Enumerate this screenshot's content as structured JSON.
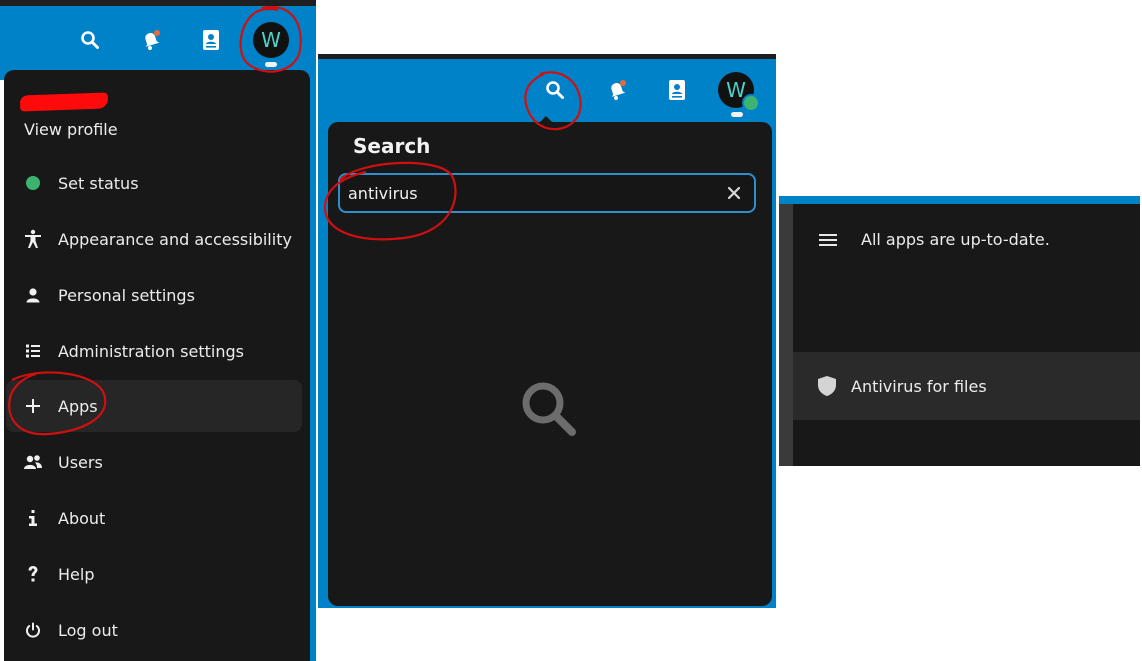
{
  "panel1": {
    "avatar_letter": "W",
    "view_profile": "View profile",
    "menu": [
      {
        "label": "Set status",
        "icon": "status-dot-icon"
      },
      {
        "label": "Appearance and accessibility",
        "icon": "accessibility-icon"
      },
      {
        "label": "Personal settings",
        "icon": "person-icon"
      },
      {
        "label": "Administration settings",
        "icon": "admin-list-icon"
      },
      {
        "label": "Apps",
        "icon": "plus-icon"
      },
      {
        "label": "Users",
        "icon": "users-icon"
      },
      {
        "label": "About",
        "icon": "info-icon"
      },
      {
        "label": "Help",
        "icon": "help-icon"
      },
      {
        "label": "Log out",
        "icon": "power-icon"
      }
    ]
  },
  "panel2": {
    "avatar_letter": "W",
    "title": "Search",
    "query": "antivirus"
  },
  "panel3": {
    "status": "All apps are up-to-date.",
    "app_name": "Antivirus for files"
  },
  "colors": {
    "header_blue": "#0082c9",
    "menu_bg": "#181818",
    "status_green": "#3cb371",
    "annotation_red": "#d01010",
    "search_border": "#2f8fce"
  }
}
